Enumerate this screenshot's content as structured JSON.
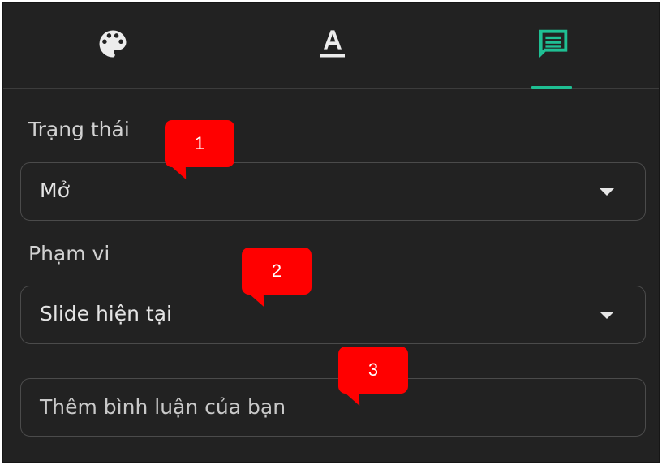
{
  "tabs": [
    {
      "name": "palette",
      "icon": "palette-icon",
      "active": false
    },
    {
      "name": "text-format",
      "icon": "text-format-icon",
      "active": false
    },
    {
      "name": "comments",
      "icon": "comment-icon",
      "active": true
    }
  ],
  "colors": {
    "panel_bg": "#222222",
    "accent": "#1fbf93",
    "callout": "#ff0000"
  },
  "status": {
    "label": "Trạng thái",
    "value": "Mở"
  },
  "scope": {
    "label": "Phạm vi",
    "value": "Slide hiện tại"
  },
  "comment": {
    "placeholder": "Thêm bình luận của bạn"
  },
  "callouts": [
    "1",
    "2",
    "3"
  ]
}
